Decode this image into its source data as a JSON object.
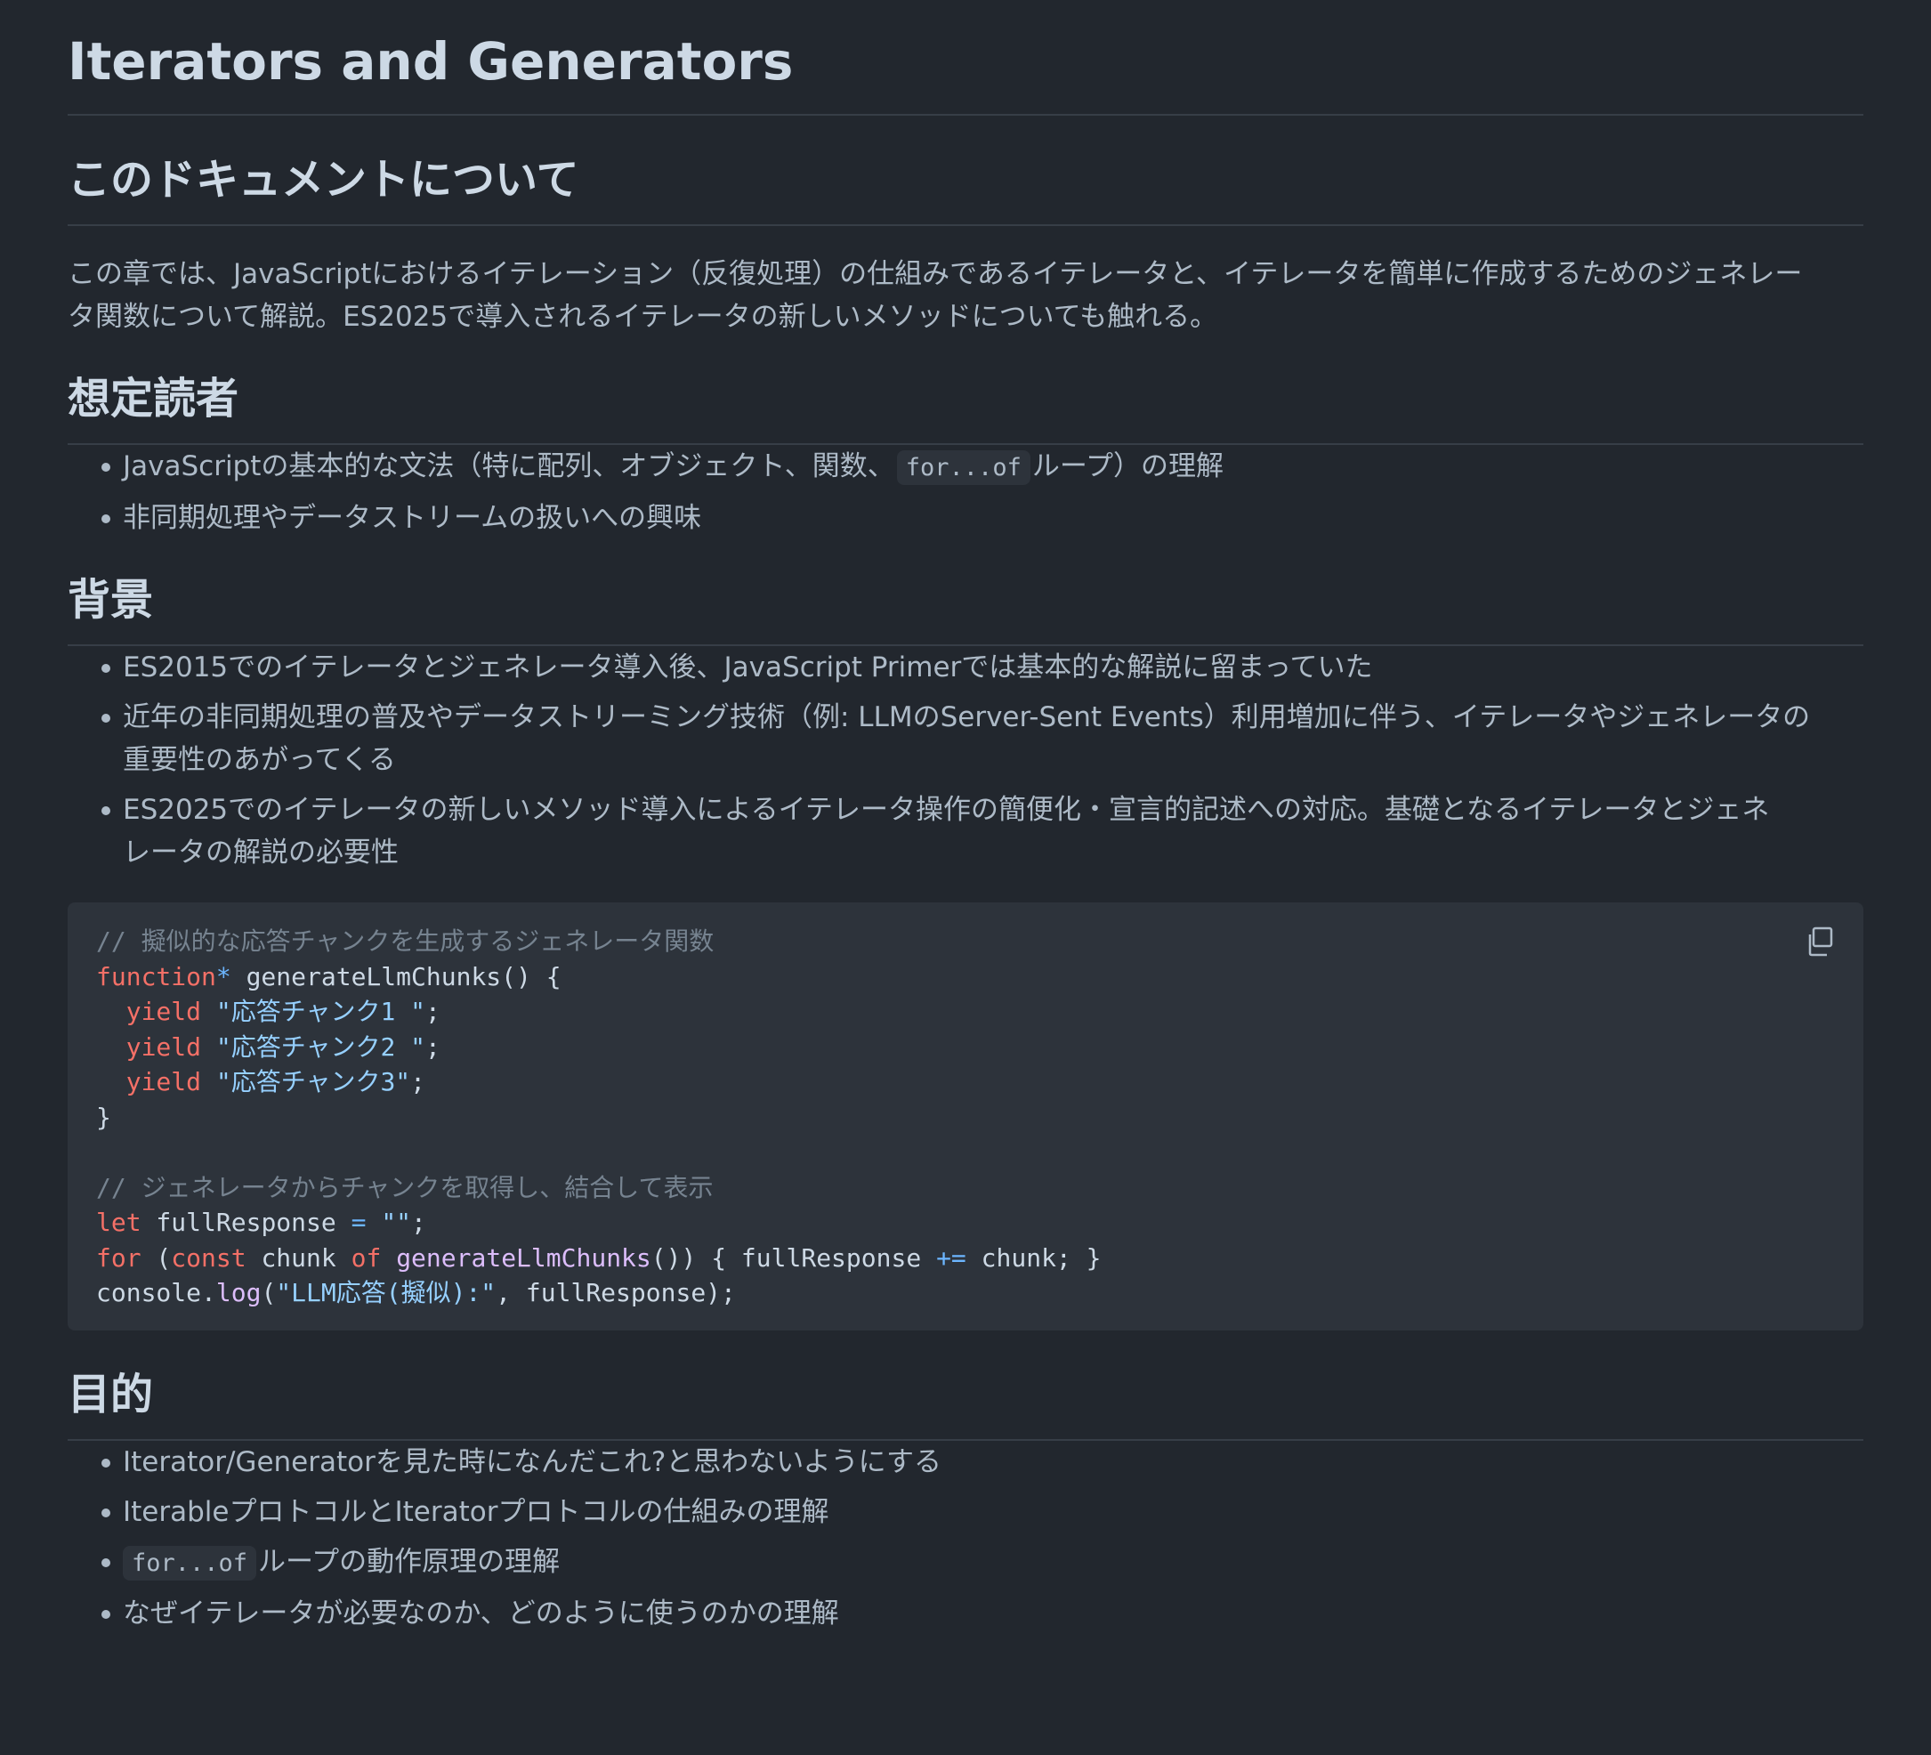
{
  "document": {
    "title": "Iterators and Generators"
  },
  "about": {
    "heading": "このドキュメントについて",
    "body_line1": "この章では、JavaScriptにおけるイテレーション（反復処理）の仕組みであるイテレータと、イテレータを簡単に作成するためのジェネレー",
    "body_line2": "タ関数について解説。ES2025で導入されるイテレータの新しいメソッドについても触れる。"
  },
  "readers": {
    "heading": "想定読者",
    "item1_pre": "JavaScriptの基本的な文法（特に配列、オブジェクト、関数、",
    "item1_code": "for...of",
    "item1_post": "ループ）の理解",
    "item2": "非同期処理やデータストリームの扱いへの興味"
  },
  "background": {
    "heading": "背景",
    "item1": "ES2015でのイテレータとジェネレータ導入後、JavaScript Primerでは基本的な解説に留まっていた",
    "item2_line1": "近年の非同期処理の普及やデータストリーミング技術（例: LLMのServer-Sent Events）利用増加に伴う、イテレータやジェネレータの",
    "item2_line2": "重要性のあがってくる",
    "item3_line1": "ES2025でのイテレータの新しいメソッド導入によるイテレータ操作の簡便化・宣言的記述への対応。基礎となるイテレータとジェネ",
    "item3_line2": "レータの解説の必要性"
  },
  "code": {
    "copy_icon": "copy-icon",
    "comment1": "// 擬似的な応答チャンクを生成するジェネレータ関数",
    "kw_function": "function",
    "star": "*",
    "fn_decl_rest": " generateLlmChunks() {",
    "indent": "  ",
    "kw_yield": "yield",
    "str1": "\"応答チャンク1 \"",
    "str2": "\"応答チャンク2 \"",
    "str3": "\"応答チャンク3\"",
    "semi": ";",
    "close_brace": "}",
    "comment2": "// ジェネレータからチャンクを取得し、結合して表示",
    "kw_let": "let",
    "let_var": " fullResponse ",
    "eq": "=",
    "empty_str": "\"\"",
    "kw_for": "for",
    "for_open": " (",
    "kw_const": "const",
    "chunk_var": " chunk ",
    "kw_of": "of",
    "fn_call": "generateLlmChunks",
    "for_mid": "()) { fullResponse ",
    "plus_eq": "+=",
    "for_end": " chunk; }",
    "console": "console.",
    "log": "log",
    "log_open": "(",
    "log_str": "\"LLM応答(擬似):\"",
    "log_end": ", fullResponse);"
  },
  "purpose": {
    "heading": "目的",
    "item1": "Iterator/Generatorを見た時になんだこれ?と思わないようにする",
    "item2": "IterableプロトコルとIteratorプロトコルの仕組みの理解",
    "item3_code": "for...of",
    "item3_post": "ループの動作原理の理解",
    "item4": "なぜイテレータが必要なのか、どのように使うのかの理解"
  },
  "colors": {
    "background": "#22272e",
    "text": "#adbac7",
    "heading": "#cdd9e5",
    "code_bg": "#2d333b",
    "keyword": "#f47067",
    "string": "#96d0ff",
    "comment": "#768390",
    "function": "#dcbdfb",
    "operator": "#6cb6ff"
  }
}
